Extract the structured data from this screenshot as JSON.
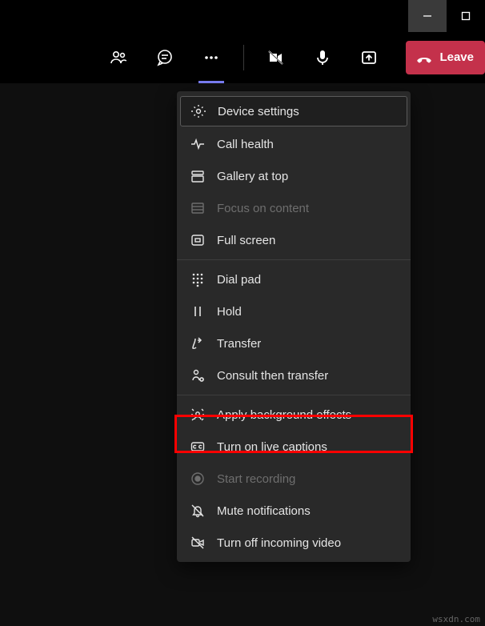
{
  "titlebar": {
    "minimize": "Minimize",
    "maximize": "Maximize"
  },
  "toolbar": {
    "people": "People",
    "chat": "Chat",
    "more": "More actions",
    "camera": "Camera (off)",
    "mic": "Microphone",
    "share": "Share content",
    "leave_label": "Leave"
  },
  "menu": {
    "items": [
      {
        "label": "Device settings",
        "disabled": false,
        "selected": true
      },
      {
        "label": "Call health",
        "disabled": false
      },
      {
        "label": "Gallery at top",
        "disabled": false
      },
      {
        "label": "Focus on content",
        "disabled": true
      },
      {
        "label": "Full screen",
        "disabled": false
      },
      {
        "sep": true
      },
      {
        "label": "Dial pad",
        "disabled": false
      },
      {
        "label": "Hold",
        "disabled": false
      },
      {
        "label": "Transfer",
        "disabled": false
      },
      {
        "label": "Consult then transfer",
        "disabled": false
      },
      {
        "sep": true
      },
      {
        "label": "Apply background effects",
        "disabled": false,
        "highlight": true
      },
      {
        "label": "Turn on live captions",
        "disabled": false
      },
      {
        "label": "Start recording",
        "disabled": true
      },
      {
        "label": "Mute notifications",
        "disabled": false
      },
      {
        "label": "Turn off incoming video",
        "disabled": false
      }
    ]
  },
  "watermark": "wsxdn.com"
}
